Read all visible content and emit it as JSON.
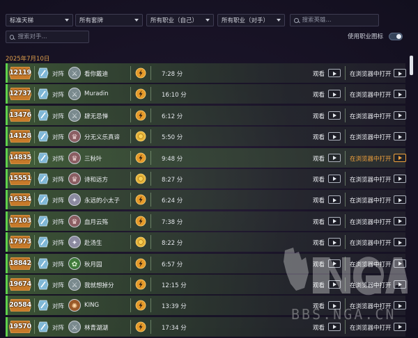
{
  "filters": {
    "mode": "标准天梯",
    "deck": "所有套牌",
    "my_class": "所有职业（自己）",
    "opp_class": "所有职业（对手）",
    "search_hero_placeholder": "搜索英雄..."
  },
  "search_opponent_placeholder": "搜索对手...",
  "toggle": {
    "label": "使用职业图标",
    "on": true
  },
  "date": "2025年7月10日",
  "row_labels": {
    "vs": "对阵",
    "watch": "观看",
    "open_browser": "在浏览器中打开"
  },
  "colors": {
    "accent": "#f2a23c",
    "win_border": "#5fd14c",
    "date": "#e2a04c",
    "rank_badge": "#c77a2a"
  },
  "matches": [
    {
      "rank": "12119",
      "opponent": "看你戴迪",
      "opp_icon": "rogue-icon",
      "result": "win-icon",
      "duration": "7:28 分"
    },
    {
      "rank": "12737",
      "opponent": "Muradin",
      "opp_icon": "rogue-icon",
      "result": "win-icon",
      "duration": "16:10 分"
    },
    {
      "rank": "13476",
      "opponent": "肆无忌惮",
      "opp_icon": "rogue-icon",
      "result": "win-icon",
      "duration": "6:12 分"
    },
    {
      "rank": "14128",
      "opponent": "分无义乐真谛",
      "opp_icon": "warrior-icon",
      "result": "coin-icon",
      "duration": "5:50 分"
    },
    {
      "rank": "14835",
      "opponent": "三秋叶",
      "opp_icon": "warrior-icon",
      "result": "win-icon",
      "duration": "9:48 分",
      "hover": true
    },
    {
      "rank": "15551",
      "opponent": "诗和远方",
      "opp_icon": "warrior-icon",
      "result": "coin-icon",
      "duration": "8:27 分"
    },
    {
      "rank": "16334",
      "opponent": "永远的小太子",
      "opp_icon": "priest-icon",
      "result": "win-icon",
      "duration": "6:24 分"
    },
    {
      "rank": "17103",
      "opponent": "血月云殇",
      "opp_icon": "warrior-icon",
      "result": "win-icon",
      "duration": "7:38 分"
    },
    {
      "rank": "17973",
      "opponent": "赴汤生",
      "opp_icon": "priest-icon",
      "result": "coin-icon",
      "duration": "8:22 分"
    },
    {
      "rank": "18842",
      "opponent": "秋月园",
      "opp_icon": "hunter-icon",
      "result": "win-icon",
      "duration": "6:57 分"
    },
    {
      "rank": "19674",
      "opponent": "我就想掉分",
      "opp_icon": "rogue-icon",
      "result": "win-icon",
      "duration": "12:15 分"
    },
    {
      "rank": "20584",
      "opponent": "KING",
      "opp_icon": "mage-icon",
      "result": "win-icon",
      "duration": "13:39 分"
    },
    {
      "rank": "19570",
      "opponent": "林青湖湖",
      "opp_icon": "rogue-icon",
      "result": "win-icon",
      "duration": "17:34 分"
    }
  ],
  "watermark": {
    "logo": "NGA",
    "url": "BBS.NGA.CN"
  }
}
